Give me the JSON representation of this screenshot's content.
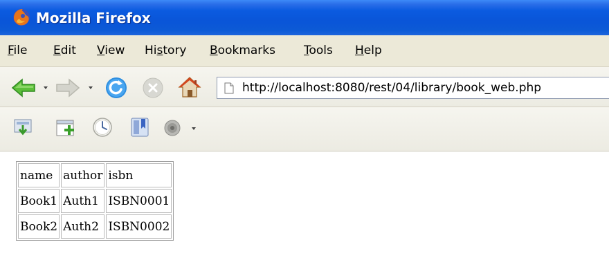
{
  "window": {
    "title": "Mozilla Firefox"
  },
  "menu": [
    {
      "label": "File",
      "underline": "F",
      "rest": "ile"
    },
    {
      "label": "Edit",
      "underline": "E",
      "rest": "dit"
    },
    {
      "label": "View",
      "underline": "V",
      "rest": "iew"
    },
    {
      "label": "History",
      "pre": "Hi",
      "underline": "s",
      "rest": "tory"
    },
    {
      "label": "Bookmarks",
      "underline": "B",
      "rest": "ookmarks"
    },
    {
      "label": "Tools",
      "underline": "T",
      "rest": "ools"
    },
    {
      "label": "Help",
      "underline": "H",
      "rest": "elp"
    }
  ],
  "navigation": {
    "url": "http://localhost:8080/rest/04/library/book_web.php",
    "icons": [
      "back-icon",
      "forward-icon",
      "reload-icon",
      "stop-icon",
      "home-icon",
      "page-icon"
    ]
  },
  "toolbar2": {
    "icons": [
      "download-icon",
      "add-tab-icon",
      "history-icon",
      "bookmarks-icon",
      "media-icon"
    ]
  },
  "table": {
    "header": [
      "name",
      "author",
      "isbn"
    ],
    "rows": [
      [
        "Book1",
        "Auth1",
        "ISBN0001"
      ],
      [
        "Book2",
        "Auth2",
        "ISBN0002"
      ]
    ]
  },
  "colors": {
    "titlebar": "#0a55d8",
    "chrome": "#ece9d8",
    "back_arrow": "#4caf3c",
    "reload": "#2f8fe0"
  }
}
